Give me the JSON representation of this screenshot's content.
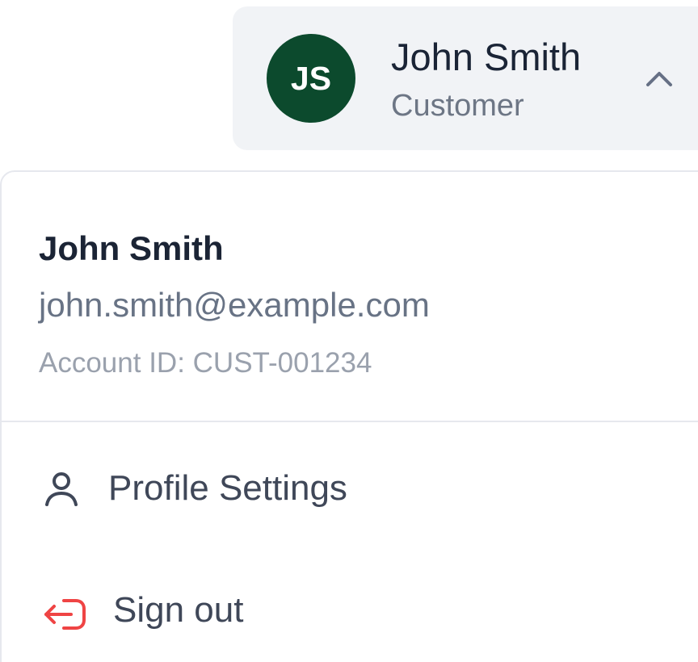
{
  "account": {
    "initials": "JS",
    "name": "John Smith",
    "role": "Customer",
    "email": "john.smith@example.com",
    "account_id": "Account ID: CUST-001234"
  },
  "menu": {
    "items": [
      {
        "label": "Profile Settings",
        "icon": "user-icon"
      },
      {
        "label": "Sign out",
        "icon": "sign-out-icon"
      }
    ]
  },
  "colors": {
    "avatar_background": "#0c4a2d",
    "trigger_background": "#f1f3f6",
    "sign_out_icon": "#ef4444",
    "primary_text": "#1b2435",
    "secondary_text": "#687385"
  }
}
